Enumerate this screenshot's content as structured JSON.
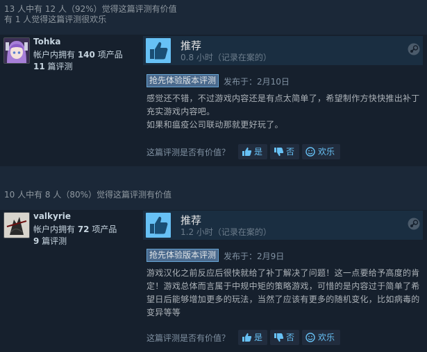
{
  "reviews": [
    {
      "helpful_summary": "13 人中有 12 人（92%）觉得这篇评测有价值",
      "funny_summary": "有 1 人觉得这篇评测很欢乐",
      "author": {
        "name": "Tohka",
        "products_prefix": "帐户内拥有 ",
        "products_count": "140",
        "products_suffix": " 项产品",
        "reviews_count": "11",
        "reviews_suffix": " 篇评测",
        "avatar_icon": "anime-avatar-purple-hair"
      },
      "recommendation": "推荐",
      "hours": "0.8 小时（记录在案的）",
      "early_access_tag": "抢先体验版本评测",
      "posted": "发布于：2月10日",
      "text": [
        "感觉还不错，不过游戏内容还是有点太简单了，希望制作方快快推出补丁充实游戏内容吧。",
        "如果和瘟疫公司联动那就更好玩了。"
      ],
      "vote_question": "这篇评测是否有价值？",
      "vote_yes": "是",
      "vote_no": "否",
      "vote_funny": "欢乐"
    },
    {
      "helpful_summary": "10 人中有 8 人（80%）觉得这篇评测有价值",
      "author": {
        "name": "valkyrie",
        "products_prefix": "帐户内拥有 ",
        "products_count": "72",
        "products_suffix": " 项产品",
        "reviews_count": "9",
        "reviews_suffix": " 篇评测",
        "avatar_icon": "ink-sketch-avatar"
      },
      "recommendation": "推荐",
      "hours": "1.2 小时（记录在案的）",
      "early_access_tag": "抢先体验版本评测",
      "posted": "发布于：2月9日",
      "text": [
        "游戏汉化之前反应后很快就给了补丁解决了问题！这一点要给予高度的肯定！游戏总体而言属于中规中矩的策略游戏，可惜的是内容过于简单了希望日后能够增加更多的玩法，当然了应该有更多的随机变化，比如病毒的变异等等"
      ],
      "vote_question": "这篇评测是否有价值？",
      "vote_yes": "是",
      "vote_no": "否",
      "vote_funny": "欢乐"
    }
  ],
  "colors": {
    "page_bg": "#1b2838",
    "link_blue": "#67c1f5",
    "tag_bg": "#4b6a8d"
  }
}
